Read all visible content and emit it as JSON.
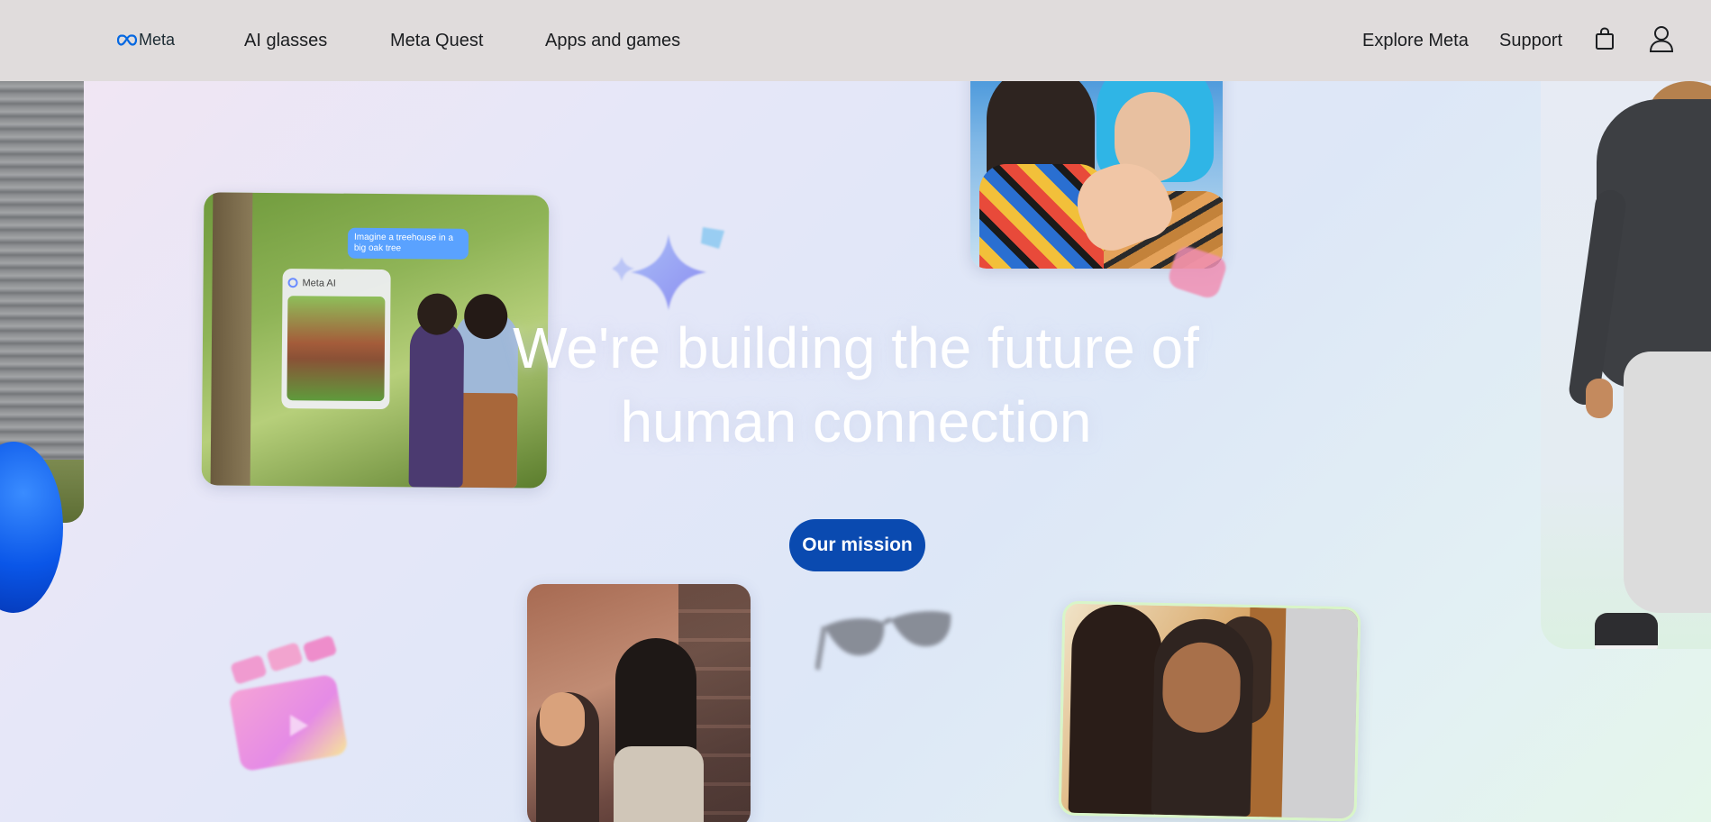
{
  "header": {
    "logo_text": "Meta",
    "nav": {
      "ai_glasses": "AI glasses",
      "meta_quest": "Meta Quest",
      "apps_and_games": "Apps and games"
    },
    "right_nav": {
      "explore_meta": "Explore Meta",
      "support": "Support"
    },
    "icons": {
      "cart": "shopping-bag-icon",
      "account": "user-icon"
    }
  },
  "hero": {
    "title_line1": "We're building the future of",
    "title_line2": "human connection",
    "button_label": "Our mission"
  },
  "cards": {
    "treehouse_prompt": "Imagine a treehouse in a big oak tree",
    "meta_ai_label": "Meta AI"
  },
  "colors": {
    "nav_background": "#e0dcdc",
    "button_background": "#0a4ab0",
    "brand_blue": "#0668e1"
  }
}
